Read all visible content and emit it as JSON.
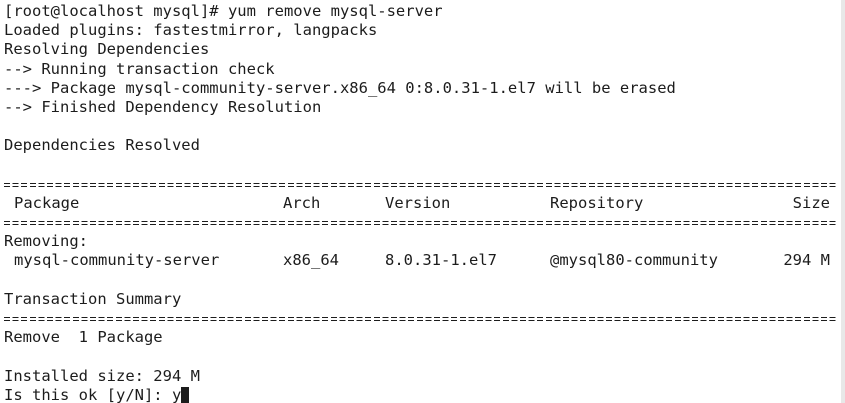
{
  "terminal": {
    "lines_top": [
      "[root@localhost mysql]# yum remove mysql-server",
      "Loaded plugins: fastestmirror, langpacks",
      "Resolving Dependencies",
      "--> Running transaction check",
      "---> Package mysql-community-server.x86_64 0:8.0.31-1.el7 will be erased",
      "--> Finished Dependency Resolution",
      "",
      "Dependencies Resolved",
      ""
    ],
    "table": {
      "headers": {
        "package": "Package",
        "arch": "Arch",
        "version": "Version",
        "repository": "Repository",
        "size": "Size"
      },
      "section_label": "Removing:",
      "rows": [
        {
          "package": "mysql-community-server",
          "arch": "x86_64",
          "version": "8.0.31-1.el7",
          "repository": "@mysql80-community",
          "size": "294 M"
        }
      ]
    },
    "transaction_summary": "Transaction Summary",
    "remove_line": "Remove  1 Package",
    "installed_size": "Installed size: 294 M",
    "prompt": "Is this ok [y/N]: y"
  }
}
